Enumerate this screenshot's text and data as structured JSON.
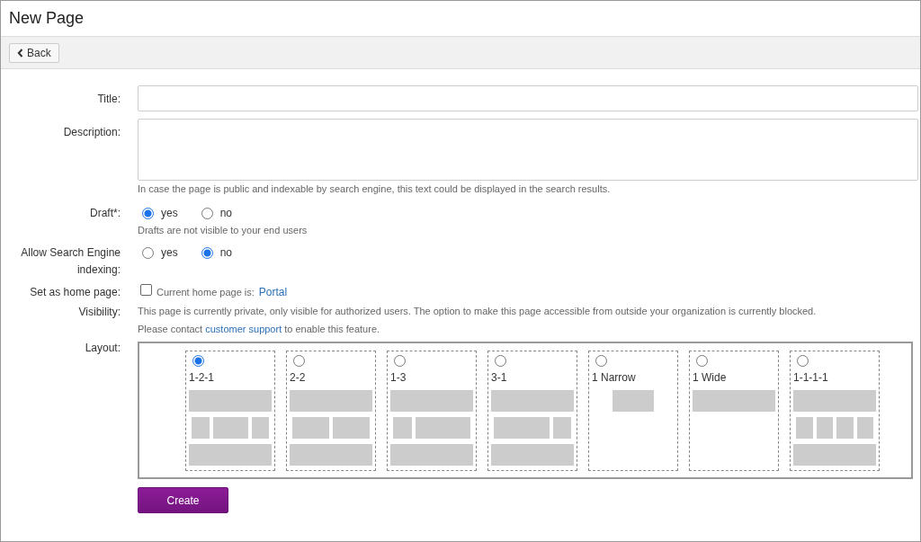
{
  "page": {
    "title": "New Page"
  },
  "toolbar": {
    "back_button": "Back"
  },
  "form": {
    "title": {
      "label": "Title:"
    },
    "description": {
      "label": "Description:",
      "help": "In case the page is public and indexable by search engine, this text could be displayed in the search results."
    },
    "draft": {
      "label": "Draft*:",
      "options": [
        {
          "label": "yes",
          "selected": true
        },
        {
          "label": "no",
          "selected": false
        }
      ],
      "help": "Drafts are not visible to your end users"
    },
    "indexing": {
      "label_lines": [
        "Allow Search Engine",
        "indexing:"
      ],
      "options": [
        {
          "label": "yes",
          "selected": false
        },
        {
          "label": "no",
          "selected": true
        }
      ]
    },
    "home_page": {
      "label": "Set as home page:",
      "checked": false,
      "text": "Current home page is:",
      "link": "Portal"
    },
    "visibility": {
      "label": "Visibility:",
      "text": "This page is currently private, only visible for authorized users. The option to make this page accessible from outside your organization is currently blocked.",
      "contact_before": "Please contact",
      "contact_link": "customer support",
      "contact_after": "to enable this feature."
    },
    "layout": {
      "label": "Layout:",
      "options": [
        {
          "label": "1-2-1",
          "kind": "wide-three-wide",
          "selected": true
        },
        {
          "label": "2-2",
          "kind": "wide-two-wide",
          "selected": false
        },
        {
          "label": "1-3",
          "kind": "wide-narrowleft-wide",
          "selected": false
        },
        {
          "label": "3-1",
          "kind": "wide-narrowright-wide",
          "selected": false
        },
        {
          "label": "1 Narrow",
          "kind": "narrow",
          "selected": false
        },
        {
          "label": "1 Wide",
          "kind": "wide",
          "selected": false
        },
        {
          "label": "1-1-1-1",
          "kind": "wide-four-wide",
          "selected": false
        }
      ]
    },
    "submit": "Create"
  }
}
